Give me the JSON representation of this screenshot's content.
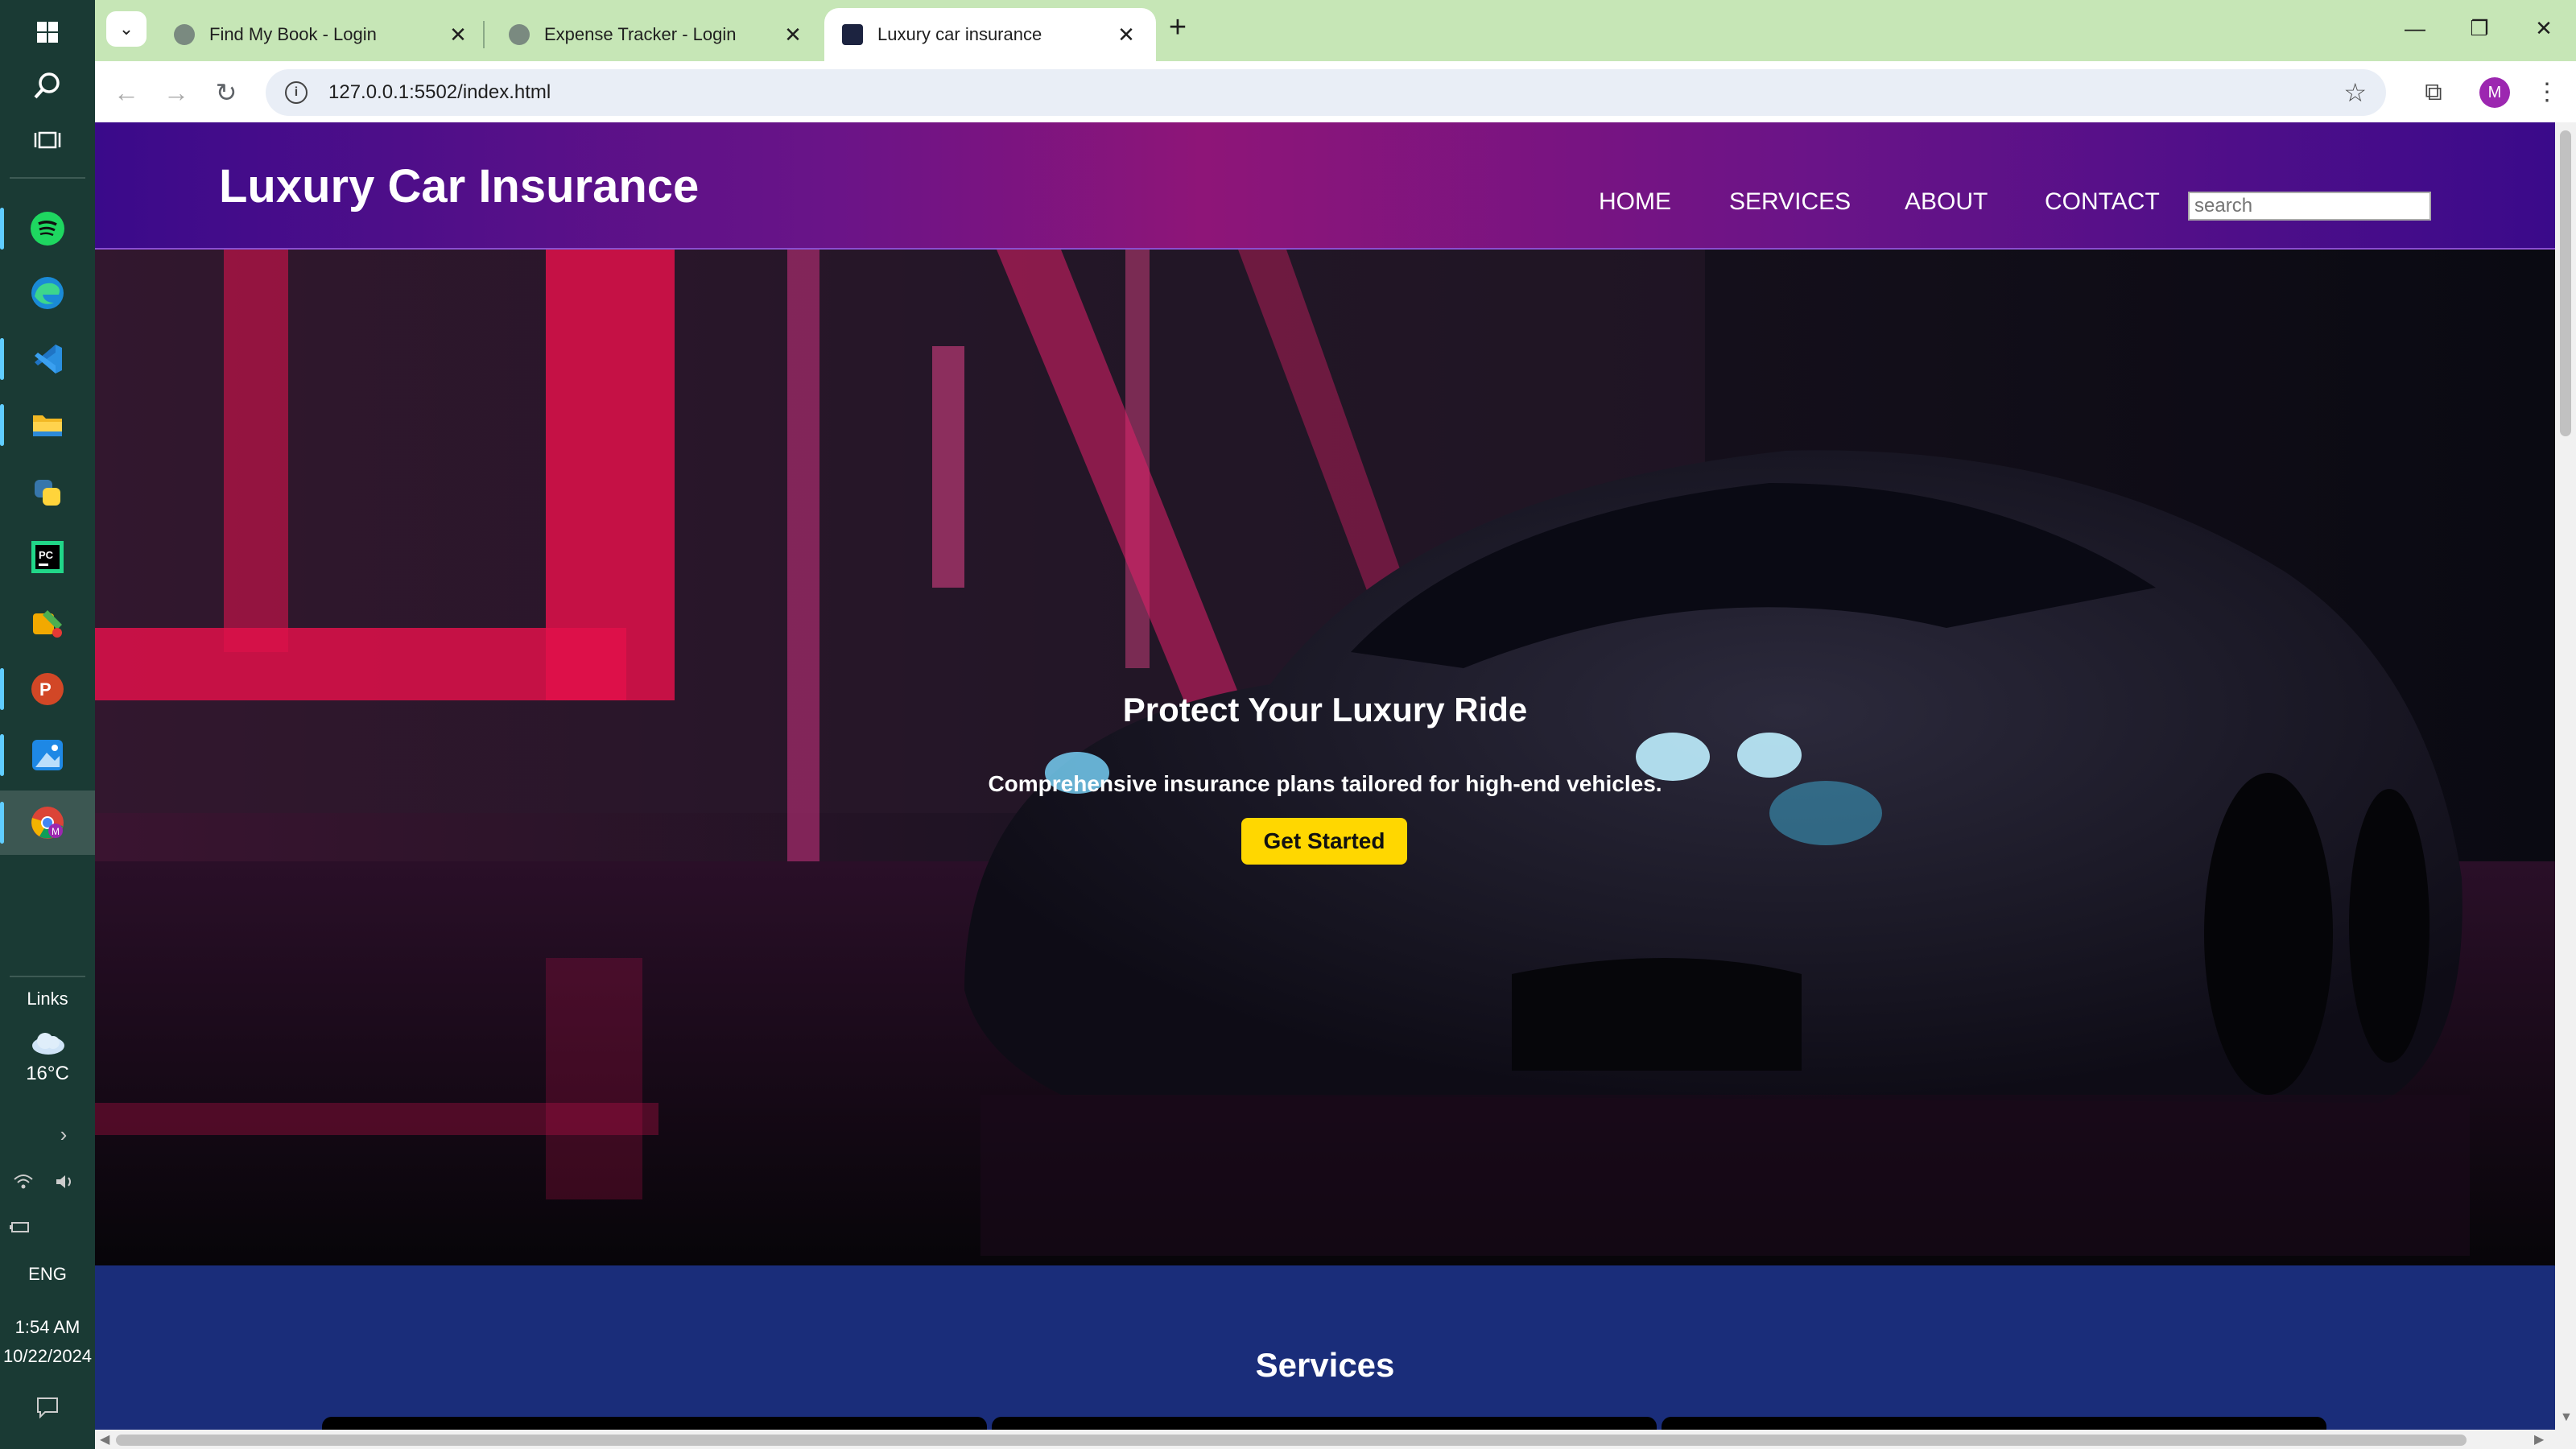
{
  "taskbar": {
    "apps": [
      {
        "name": "start"
      },
      {
        "name": "search"
      },
      {
        "name": "task-view"
      },
      {
        "name": "spotify"
      },
      {
        "name": "edge"
      },
      {
        "name": "vscode"
      },
      {
        "name": "file-explorer"
      },
      {
        "name": "python"
      },
      {
        "name": "pycharm"
      },
      {
        "name": "app-tools"
      },
      {
        "name": "powerpoint"
      },
      {
        "name": "photos"
      },
      {
        "name": "chrome"
      }
    ],
    "links_label": "Links",
    "weather_temp": "16°C",
    "language": "ENG",
    "time": "1:54 AM",
    "date": "10/22/2024"
  },
  "browser": {
    "tabs": [
      {
        "title": "Find My Book - Login"
      },
      {
        "title": "Expense Tracker - Login"
      },
      {
        "title": "Luxury car insurance"
      }
    ],
    "url": "127.0.0.1:5502/index.html",
    "profile_initial": "M"
  },
  "site": {
    "logo": "Luxury Car Insurance",
    "nav": [
      "HOME",
      "SERVICES",
      "ABOUT",
      "CONTACT"
    ],
    "search_placeholder": "search",
    "hero": {
      "title": "Protect Your Luxury Ride",
      "subtitle": "Comprehensive insurance plans tailored for high-end vehicles.",
      "cta": "Get Started"
    },
    "services_title": "Services"
  },
  "colors": {
    "header_purple": "#6a1488",
    "cta_yellow": "#ffd700",
    "services_blue": "#1a2d7a",
    "tab_strip": "#c6e6b6"
  }
}
